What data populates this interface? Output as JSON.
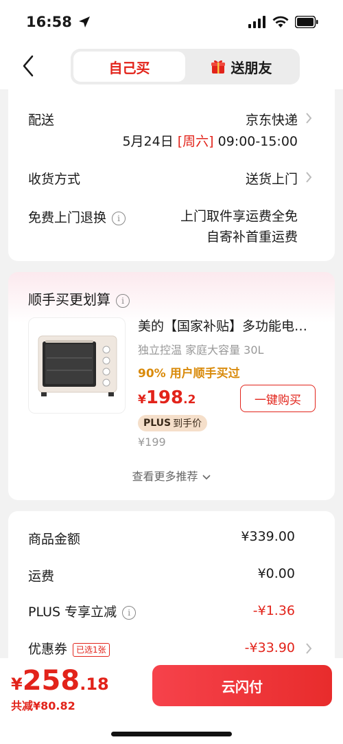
{
  "status_bar": {
    "time": "16:58"
  },
  "header": {
    "tabs": [
      {
        "label": "自己买",
        "active": true
      },
      {
        "label": "送朋友",
        "active": false
      }
    ]
  },
  "delivery": {
    "label": "配送",
    "carrier": "京东快递",
    "date": "5月24日",
    "weekday": "[周六]",
    "time_range": "09:00-15:00",
    "receive_label": "收货方式",
    "receive_value": "送货上门",
    "return_label": "免费上门退换",
    "return_line1": "上门取件享运费全免",
    "return_line2": "自寄补首重运费"
  },
  "recommend": {
    "title": "顺手买更划算",
    "product_title": "美的【国家补贴】多功能电烤箱",
    "product_sub": "独立控温 家庭大容量 30L",
    "hot_text": "90% 用户顺手买过",
    "price_symbol": "¥",
    "price_int": "198",
    "price_dec": ".2",
    "buy_button": "一键购买",
    "plus_label": "PLUS",
    "plus_text": "到手价",
    "orig_price": "¥199",
    "see_more": "查看更多推荐"
  },
  "summary": {
    "rows": [
      {
        "label": "商品金额",
        "value": "¥339.00"
      },
      {
        "label": "运费",
        "value": "¥0.00"
      },
      {
        "label": "PLUS 专享立减",
        "value": "-¥1.36"
      },
      {
        "label": "优惠券",
        "value": "-¥33.90",
        "tag": "已选1张"
      }
    ]
  },
  "bottom": {
    "currency": "¥",
    "total_int": "258",
    "total_dec": ".18",
    "discount": "共减¥80.82",
    "pay_button": "云闪付"
  },
  "colors": {
    "accent": "#e2231a",
    "hot": "#d98a0a"
  }
}
